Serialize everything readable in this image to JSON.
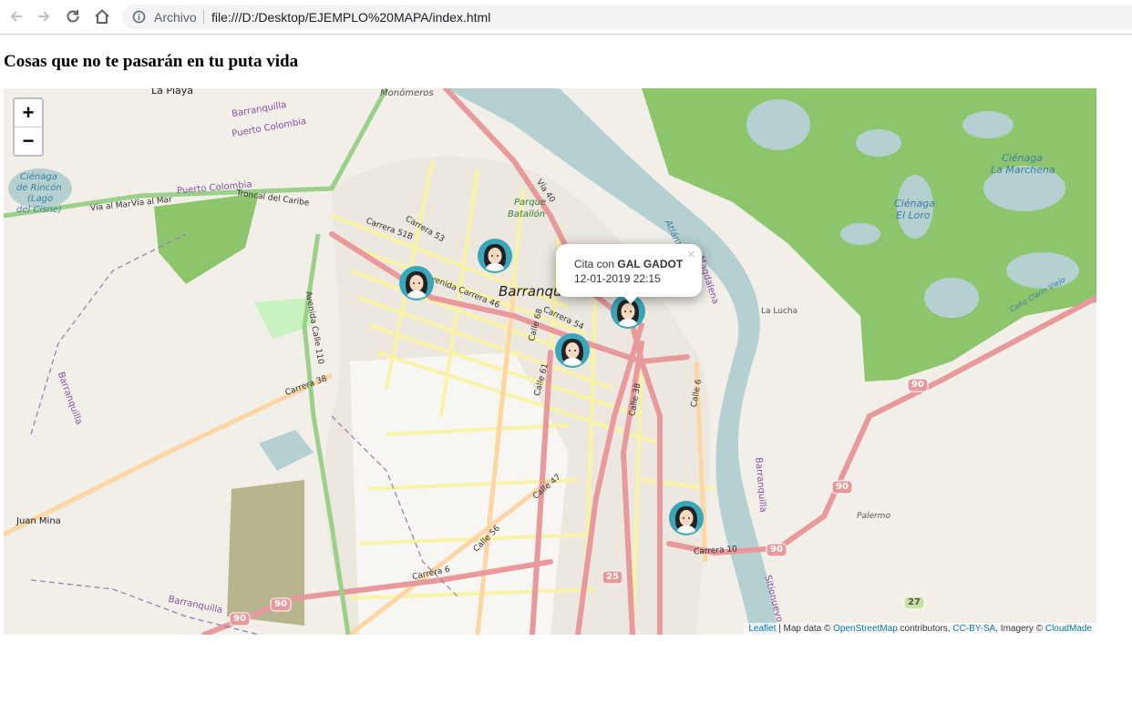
{
  "browser": {
    "security_label": "Archivo",
    "url": "file:///D:/Desktop/EJEMPLO%20MAPA/index.html"
  },
  "page": {
    "title": "Cosas que no te pasarán en tu puta vida"
  },
  "map": {
    "zoom_in_label": "+",
    "zoom_out_label": "−",
    "popup": {
      "prefix": "Cita con",
      "name": "GAL GADOT",
      "datetime": "12-01-2019 22:15",
      "close_label": "×"
    },
    "attribution": {
      "leaflet": "Leaflet",
      "sep1": " | Map data © ",
      "osm": "OpenStreetMap",
      "sep2": " contributors, ",
      "license": "CC-BY-SA",
      "sep3": ", Imagery © ",
      "imagery": "CloudMade"
    },
    "place_labels": {
      "la_playa": "La Playa",
      "monomeros": "Monómeros",
      "barranquilla_top": "Barranquilla",
      "puerto_colombia": "Puerto Colombia",
      "puerto_colombia_2": "Puerto Colombia",
      "cienaga_rincon_1": "Ciénaga",
      "cienaga_rincon_2": "de Rincón",
      "cienaga_rincon_3": "(Lago",
      "cienaga_rincon_4": "del Cisne)",
      "via_al_mar_1": "Vía al Mar",
      "via_al_mar_2": "Vía al Mar",
      "roncal": "Troncal del Caribe",
      "carrera_51b": "Carrera 51B",
      "carrera_53": "Carrera 53",
      "parque_1": "Parque",
      "parque_2": "Batallón",
      "via_40": "Vía 40",
      "barranquilla_city": "Barranquilla",
      "avenida_carrera_46": "Avenida Carrera 46",
      "carrera_54": "Carrera 54",
      "calle_68": "Calle 68",
      "calle_61": "Calle 61",
      "calle_38": "Calle 38",
      "calle_6": "Calle 6",
      "atlantico": "Atlántico",
      "magdalena": "Magdalena",
      "cienaga_loro_1": "Ciénaga",
      "cienaga_loro_2": "El Loro",
      "cienaga_marchena_1": "Ciénaga",
      "cienaga_marchena_2": "La Marchena",
      "la_lucha": "La Lucha",
      "cano_clarin": "Caño Clarín Viejo",
      "avenida_calle_110": "Avenida Calle 110",
      "carrera_38": "Carrera 38",
      "barranquilla_left": "Barranquilla",
      "barranquilla_river": "Barranquilla",
      "juan_mina": "Juan Mina",
      "calle_47": "Calle 47",
      "calle_56": "Calle 56",
      "carrera_6": "Carrera 6",
      "carrera_10": "Carrera 10",
      "palermo": "Palermo",
      "sitionuevo": "Sitionuevo",
      "barranquilla_bottom": "Barranquilla",
      "route_90_a": "90",
      "route_90_b": "90",
      "route_90_c": "90",
      "route_90_d": "90",
      "route_90_e": "90",
      "route_25": "25",
      "route_27": "27"
    },
    "marker_icon": "woman-avatar-icon",
    "colors": {
      "marker_teal": "#3aa6b9",
      "water": "#b5d0d0",
      "park": "#8dc56c",
      "land": "#f2efe9",
      "road_primary": "#e8999b",
      "road_secondary": "#f8f3a6",
      "road_tertiary": "#fcd6a4",
      "popup_close": "#c3c3c3",
      "link": "#0078a8"
    }
  }
}
